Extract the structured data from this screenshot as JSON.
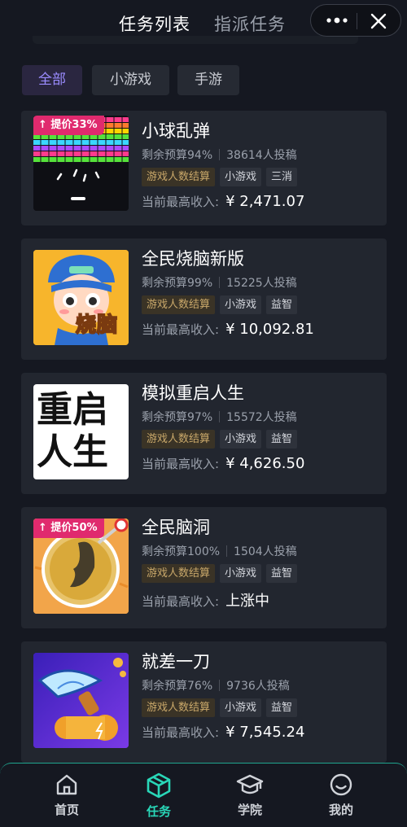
{
  "header": {
    "tab_active": "任务列表",
    "tab_inactive": "指派任务",
    "more_icon": "more-dots-icon",
    "close_icon": "close-icon"
  },
  "filters": [
    {
      "label": "全部",
      "active": true
    },
    {
      "label": "小游戏",
      "active": false
    },
    {
      "label": "手游",
      "active": false
    }
  ],
  "tasks": [
    {
      "name": "小球乱弹",
      "budget": "剩余预算94%",
      "submissions": "38614人投稿",
      "tags": [
        "游戏人数结算",
        "小游戏",
        "三消"
      ],
      "income_label": "当前最高收入:",
      "income_value": "¥ 2,471.07",
      "badge": "提价33%"
    },
    {
      "name": "全民烧脑新版",
      "budget": "剩余预算99%",
      "submissions": "15225人投稿",
      "tags": [
        "游戏人数结算",
        "小游戏",
        "益智"
      ],
      "income_label": "当前最高收入:",
      "income_value": "¥ 10,092.81",
      "thumb_text": "烧脑"
    },
    {
      "name": "模拟重启人生",
      "budget": "剩余预算97%",
      "submissions": "15572人投稿",
      "tags": [
        "游戏人数结算",
        "小游戏",
        "益智"
      ],
      "income_label": "当前最高收入:",
      "income_value": "¥ 4,626.50",
      "thumb_text": [
        "重",
        "启",
        "人",
        "生"
      ]
    },
    {
      "name": "全民脑洞",
      "budget": "剩余预算100%",
      "submissions": "1504人投稿",
      "tags": [
        "游戏人数结算",
        "小游戏",
        "益智"
      ],
      "income_label": "当前最高收入:",
      "income_value": "上涨中",
      "badge": "提价50%"
    },
    {
      "name": "就差一刀",
      "budget": "剩余预算76%",
      "submissions": "9736人投稿",
      "tags": [
        "游戏人数结算",
        "小游戏",
        "益智"
      ],
      "income_label": "当前最高收入:",
      "income_value": "¥ 7,545.24"
    }
  ],
  "bottom_nav": [
    {
      "label": "首页",
      "icon": "home-icon",
      "active": false
    },
    {
      "label": "任务",
      "icon": "cube-icon",
      "active": true
    },
    {
      "label": "学院",
      "icon": "graduation-cap-icon",
      "active": false
    },
    {
      "label": "我的",
      "icon": "smiley-icon",
      "active": false
    }
  ],
  "colors": {
    "background": "#151821",
    "card": "#22262f",
    "accent_active_nav": "#29d7b8",
    "chip_active_text": "#9b8cff",
    "badge": "#e02a6e",
    "gold_tag_text": "#c9a86a"
  }
}
